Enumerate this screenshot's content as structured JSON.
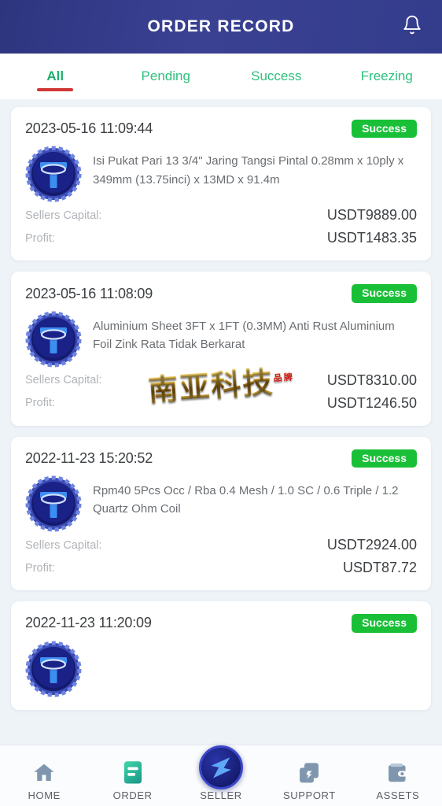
{
  "header": {
    "title": "ORDER RECORD",
    "bell_icon": "bell-icon"
  },
  "tabs": [
    {
      "label": "All",
      "active": true
    },
    {
      "label": "Pending",
      "active": false
    },
    {
      "label": "Success",
      "active": false
    },
    {
      "label": "Freezing",
      "active": false
    }
  ],
  "labels": {
    "sellers_capital": "Sellers Capital:",
    "profit": "Profit:"
  },
  "watermark": {
    "text": "南亚科技",
    "seal": "品牌"
  },
  "orders": [
    {
      "date": "2023-05-16 11:09:44",
      "status": "Success",
      "coin_icon": "usdt-coin-icon",
      "description": "Isi Pukat Pari 13 3/4\" Jaring Tangsi Pintal 0.28mm x 10ply x 349mm (13.75inci) x 13MD x 91.4m",
      "sellers_capital": "USDT9889.00",
      "profit": "USDT1483.35"
    },
    {
      "date": "2023-05-16 11:08:09",
      "status": "Success",
      "coin_icon": "usdt-coin-icon",
      "description": "Aluminium Sheet 3FT x 1FT (0.3MM) Anti Rust Aluminium Foil Zink Rata Tidak Berkarat",
      "sellers_capital": "USDT8310.00",
      "profit": "USDT1246.50"
    },
    {
      "date": "2022-11-23 15:20:52",
      "status": "Success",
      "coin_icon": "usdt-coin-icon",
      "description": "Rpm40 5Pcs Occ / Rba 0.4 Mesh / 1.0 SC / 0.6 Triple / 1.2 Quartz Ohm Coil",
      "sellers_capital": "USDT2924.00",
      "profit": "USDT87.72"
    },
    {
      "date": "2022-11-23 11:20:09",
      "status": "Success",
      "coin_icon": "usdt-coin-icon",
      "description": "",
      "sellers_capital": "",
      "profit": ""
    }
  ],
  "bottom_nav": [
    {
      "label": "HOME",
      "icon": "home-icon",
      "active": false
    },
    {
      "label": "ORDER",
      "icon": "order-icon",
      "active": true
    },
    {
      "label": "SELLER",
      "icon": "seller-icon",
      "active": false
    },
    {
      "label": "SUPPORT",
      "icon": "support-icon",
      "active": false
    },
    {
      "label": "ASSETS",
      "icon": "assets-icon",
      "active": false
    }
  ],
  "colors": {
    "header_blue": "#343c8c",
    "tab_green": "#2ec07c",
    "tab_underline_red": "#d03636",
    "status_green": "#19c037",
    "page_bg": "#eef3f8",
    "order_active_teal": "#2fb89a",
    "nav_icon_gray": "#7f96ae"
  }
}
